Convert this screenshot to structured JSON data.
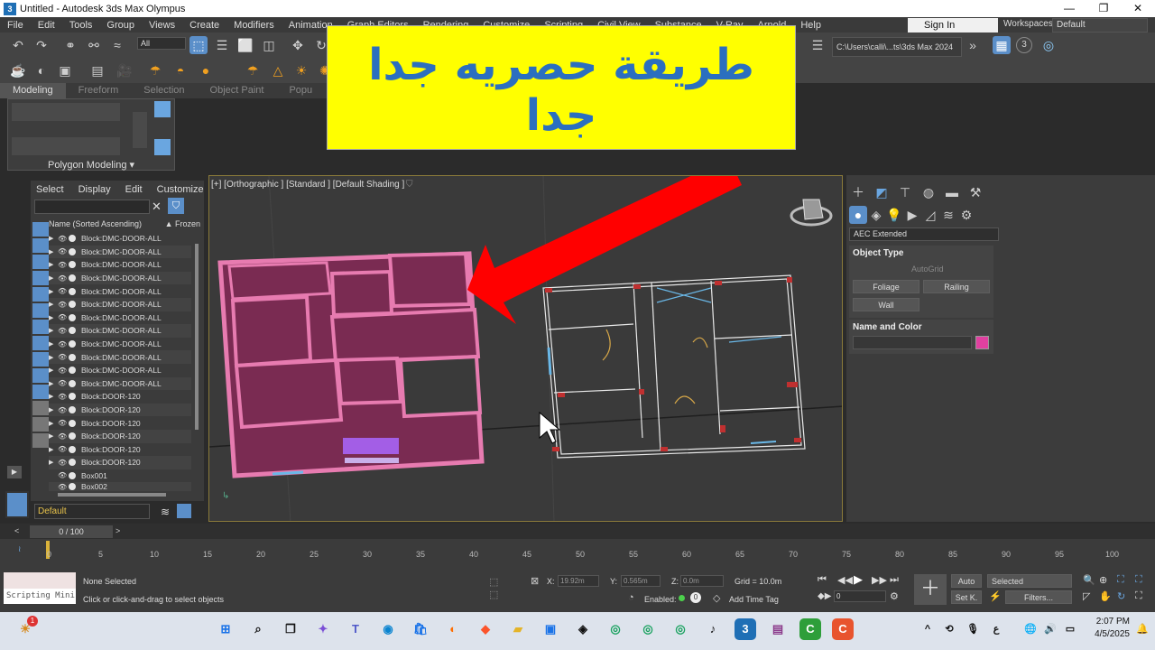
{
  "window": {
    "title": "Untitled - Autodesk 3ds Max Olympus",
    "controls": [
      "—",
      "❐",
      "✕"
    ]
  },
  "menu": [
    "File",
    "Edit",
    "Tools",
    "Group",
    "Views",
    "Create",
    "Modifiers",
    "Animation",
    "Graph Editors",
    "Rendering",
    "Customize",
    "Scripting",
    "Civil View",
    "Substance",
    "V-Ray",
    "Arnold",
    "Help"
  ],
  "signin": "Sign In",
  "workspaces": {
    "label": "Workspaces:",
    "value": "Default"
  },
  "toolbar": {
    "selection_filter": "All",
    "project_path": "C:\\Users\\calli\\...ts\\3ds Max 2024",
    "badge": "3"
  },
  "ribbon": {
    "tabs": [
      "Modeling",
      "Freeform",
      "Selection",
      "Object Paint",
      "Popu"
    ],
    "panel_label": "Polygon Modeling ▾"
  },
  "banner": {
    "text": "طريقة حصريه جدا جدا",
    "color": "#ffff00",
    "text_color": "#2b6fbf",
    "arrow_color": "#ff0000"
  },
  "scene_explorer": {
    "menu": [
      "Select",
      "Display",
      "Edit",
      "Customize"
    ],
    "column": "Name (Sorted Ascending)",
    "frozen": "▲ Frozen",
    "items": [
      "Block:DMC-DOOR-ALL",
      "Block:DMC-DOOR-ALL",
      "Block:DMC-DOOR-ALL",
      "Block:DMC-DOOR-ALL",
      "Block:DMC-DOOR-ALL",
      "Block:DMC-DOOR-ALL",
      "Block:DMC-DOOR-ALL",
      "Block:DMC-DOOR-ALL",
      "Block:DMC-DOOR-ALL",
      "Block:DMC-DOOR-ALL",
      "Block:DMC-DOOR-ALL",
      "Block:DMC-DOOR-ALL",
      "Block:DOOR-120",
      "Block:DOOR-120",
      "Block:DOOR-120",
      "Block:DOOR-120",
      "Block:DOOR-120",
      "Block:DOOR-120",
      "Box001",
      "Box002"
    ],
    "layer": "Default"
  },
  "viewport": {
    "label": "[+] [Orthographic ] [Standard ] [Default Shading ]",
    "building_color": "#7a2b52",
    "wall_color": "#e77bb0"
  },
  "command_panel": {
    "category": "AEC Extended",
    "object_type_title": "Object Type",
    "autogrid": "AutoGrid",
    "buttons": [
      "Foliage",
      "Railing",
      "Wall"
    ],
    "name_color_title": "Name and Color",
    "swatch_color": "#e040a0"
  },
  "timeline": {
    "frame": "0 / 100",
    "ticks": [
      "0",
      "5",
      "10",
      "15",
      "20",
      "25",
      "30",
      "35",
      "40",
      "45",
      "50",
      "55",
      "60",
      "65",
      "70",
      "75",
      "80",
      "85",
      "90",
      "95",
      "100"
    ]
  },
  "status": {
    "script_mini": "Scripting Mini",
    "selection": "None Selected",
    "prompt": "Click or click-and-drag to select objects",
    "x_label": "X:",
    "x": "19.92m",
    "y_label": "Y:",
    "y": "0.565m",
    "z_label": "Z:",
    "z": "0.0m",
    "grid": "Grid = 10.0m",
    "enabled": "Enabled:",
    "add_time_tag": "Add Time Tag",
    "auto": "Auto",
    "set_key": "Set K.",
    "selected": "Selected",
    "filters": "Filters...",
    "frame_field": "0"
  },
  "taskbar": {
    "time": "2:07 PM",
    "date": "4/5/2025",
    "lang": "ع",
    "notif": "1"
  }
}
